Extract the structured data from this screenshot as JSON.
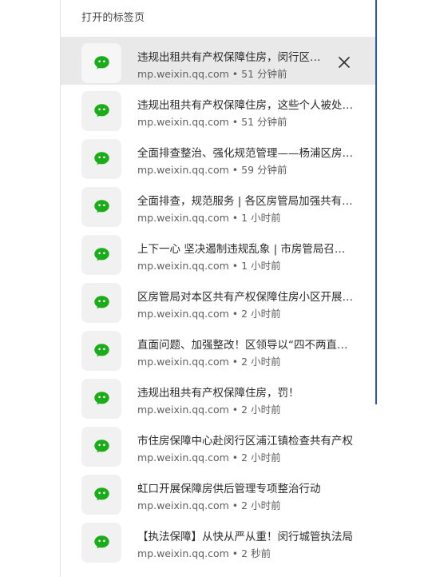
{
  "panel": {
    "title": "打开的标签页"
  },
  "tabs": [
    {
      "title": "违规出租共有产权保障住房，闵行区房管局...",
      "domain": "mp.weixin.qq.com",
      "separator": "•",
      "time": "51 分钟前",
      "active": true,
      "icon": "wechat-icon"
    },
    {
      "title": "违规出租共有产权保障住房，这些个人被处罚了",
      "domain": "mp.weixin.qq.com",
      "separator": "•",
      "time": "51 分钟前",
      "active": false,
      "icon": "wechat-icon"
    },
    {
      "title": "全面排查整治、强化规范管理——杨浦区房管局",
      "domain": "mp.weixin.qq.com",
      "separator": "•",
      "time": "59 分钟前",
      "active": false,
      "icon": "wechat-icon"
    },
    {
      "title": "全面排查，规范服务 | 各区房管局加强共有产权",
      "domain": "mp.weixin.qq.com",
      "separator": "•",
      "time": "1 小时前",
      "active": false,
      "icon": "wechat-icon"
    },
    {
      "title": "上下一心 坚决遏制违规乱象 | 市房管局召开会议",
      "domain": "mp.weixin.qq.com",
      "separator": "•",
      "time": "1 小时前",
      "active": false,
      "icon": "wechat-icon"
    },
    {
      "title": "区房管局对本区共有产权保障住房小区开展排查",
      "domain": "mp.weixin.qq.com",
      "separator": "•",
      "time": "2 小时前",
      "active": false,
      "icon": "wechat-icon"
    },
    {
      "title": "直面问题、加强整改！区领导以“四不两直”方式",
      "domain": "mp.weixin.qq.com",
      "separator": "•",
      "time": "2 小时前",
      "active": false,
      "icon": "wechat-icon"
    },
    {
      "title": "违规出租共有产权保障住房，罚！",
      "domain": "mp.weixin.qq.com",
      "separator": "•",
      "time": "2 小时前",
      "active": false,
      "icon": "wechat-icon"
    },
    {
      "title": "市住房保障中心赴闵行区浦江镇检查共有产权",
      "domain": "mp.weixin.qq.com",
      "separator": "•",
      "time": "2 小时前",
      "active": false,
      "icon": "wechat-icon"
    },
    {
      "title": "虹口开展保障房供后管理专项整治行动",
      "domain": "mp.weixin.qq.com",
      "separator": "•",
      "time": "2 小时前",
      "active": false,
      "icon": "wechat-icon"
    },
    {
      "title": "【执法保障】从快从严从重！闵行城管执法局",
      "domain": "mp.weixin.qq.com",
      "separator": "•",
      "time": "2 秒前",
      "active": false,
      "icon": "wechat-icon"
    }
  ],
  "colors": {
    "wechat_green": "#1aad19",
    "active_row": "#e9e9e9",
    "accent_border": "#2b5aa8"
  }
}
